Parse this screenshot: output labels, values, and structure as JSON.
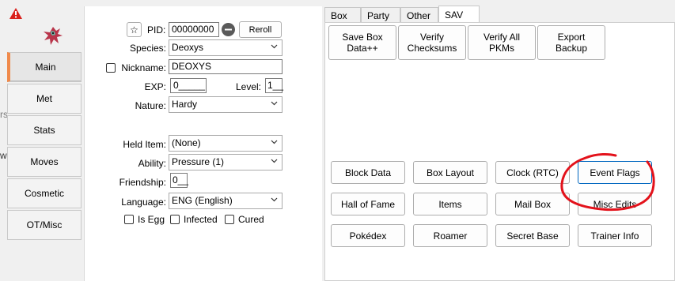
{
  "left_strip": {
    "side_tabs": [
      "Main",
      "Met",
      "Stats",
      "Moves",
      "Cosmetic",
      "OT/Misc"
    ],
    "partial_text_1": "rs",
    "partial_text_2": "w"
  },
  "pkm": {
    "star": "☆",
    "pid_label": "PID:",
    "pid_value": "00000000",
    "reroll_label": "Reroll",
    "species_label": "Species:",
    "species_value": "Deoxys",
    "nickname_label": "Nickname:",
    "nickname_value": "DEOXYS",
    "exp_label": "EXP:",
    "exp_value": "0_____",
    "level_label": "Level:",
    "level_value": "1__",
    "nature_label": "Nature:",
    "nature_value": "Hardy",
    "held_item_label": "Held Item:",
    "held_item_value": "(None)",
    "ability_label": "Ability:",
    "ability_value": "Pressure (1)",
    "friendship_label": "Friendship:",
    "friendship_value": "0__",
    "language_label": "Language:",
    "language_value": "ENG (English)",
    "is_egg_label": "Is Egg",
    "infected_label": "Infected",
    "cured_label": "Cured"
  },
  "right_tabs": [
    "Box",
    "Party",
    "Other",
    "SAV"
  ],
  "sav": {
    "top_buttons": [
      "Save Box\nData++",
      "Verify\nChecksums",
      "Verify All\nPKMs",
      "Export\nBackup"
    ],
    "grid_row1": [
      "Block Data",
      "Box Layout",
      "Clock (RTC)",
      "Event Flags"
    ],
    "grid_row2": [
      "Hall of Fame",
      "Items",
      "Mail Box",
      "Misc Edits"
    ],
    "grid_row3": [
      "Pokédex",
      "Roamer",
      "Secret Base",
      "Trainer Info"
    ]
  },
  "colors": {
    "active_tab_accent": "#f08a4b",
    "annotation_red": "#e3121b",
    "warning_red": "#d9211c"
  },
  "icons": [
    "warning-icon",
    "pokemon-sprite",
    "chevron-down-icon",
    "minus-icon",
    "star-icon"
  ]
}
